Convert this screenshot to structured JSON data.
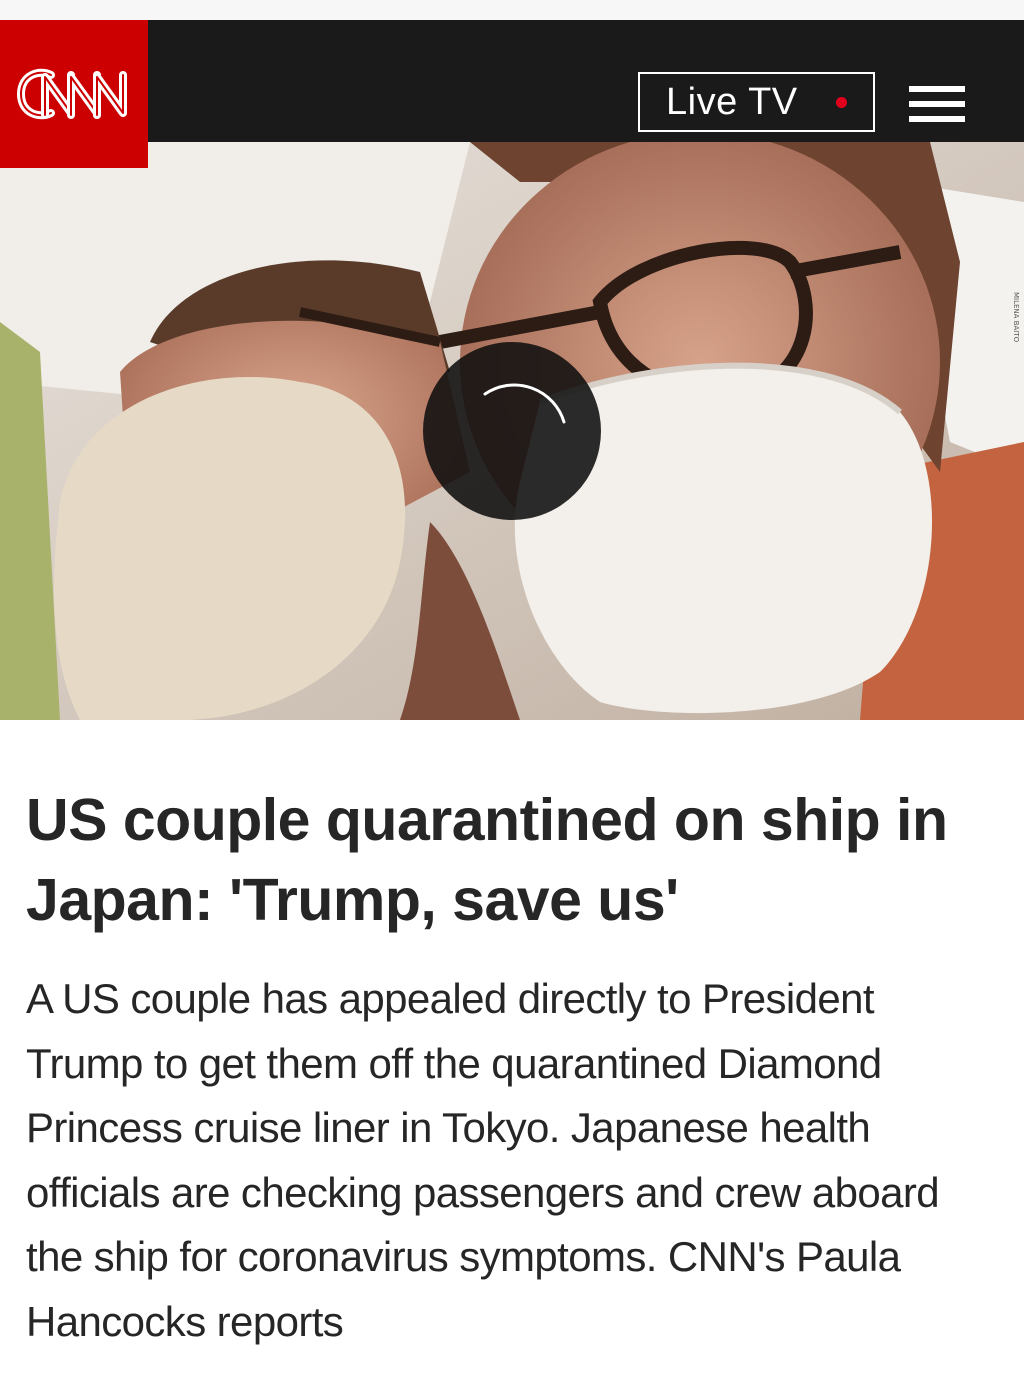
{
  "header": {
    "logo_text": "CNN",
    "live_tv_label": "Live TV",
    "menu_icon": "hamburger-menu-icon",
    "brand_red": "#cc0000",
    "bar_color": "#1a1a1a",
    "live_dot_color": "#e3001b"
  },
  "video": {
    "photo_credit": "MILENA BAITO",
    "loading_icon": "loading-spinner-icon"
  },
  "article": {
    "headline": "US couple quarantined on ship in Japan: 'Trump, save us'",
    "description": "A US couple has appealed directly to President Trump to get them off the quarantined Diamond Princess cruise liner in Tokyo. Japanese health officials are checking passengers and crew aboard the ship for coronavirus symptoms. CNN's Paula Hancocks reports"
  }
}
